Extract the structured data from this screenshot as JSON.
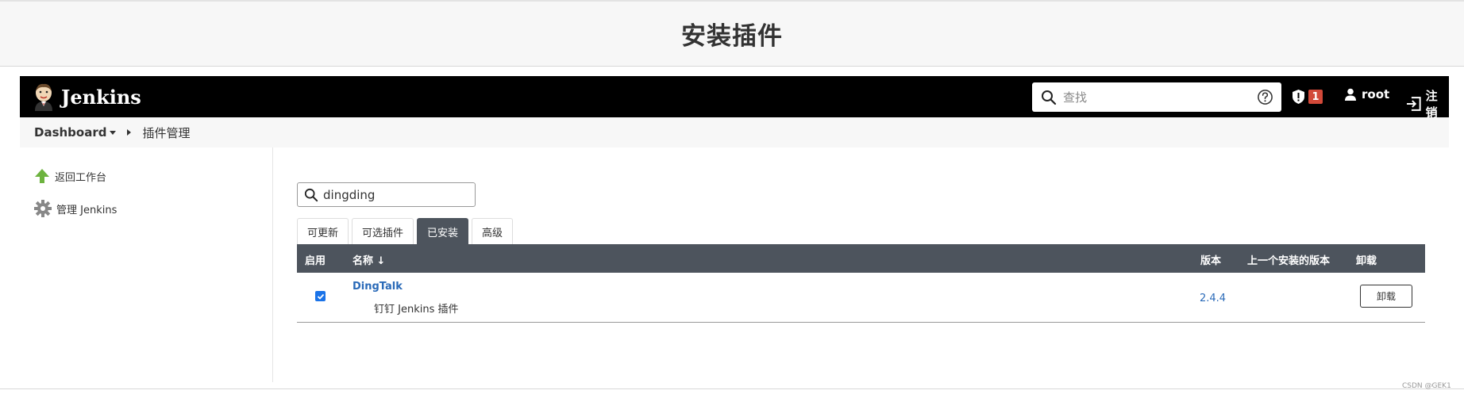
{
  "page_title": "安装插件",
  "topbar": {
    "brand": "Jenkins",
    "search_placeholder": "查找",
    "alert_count": "1",
    "user": "root",
    "logout": "注销"
  },
  "breadcrumb": {
    "dashboard": "Dashboard",
    "current": "插件管理"
  },
  "sidebar": {
    "items": [
      {
        "label": "返回工作台",
        "icon": "up-arrow-icon"
      },
      {
        "label": "管理 Jenkins",
        "icon": "gear-icon"
      }
    ]
  },
  "filter": {
    "value": "dingding"
  },
  "tabs": [
    {
      "label": "可更新",
      "active": false
    },
    {
      "label": "可选插件",
      "active": false
    },
    {
      "label": "已安装",
      "active": true
    },
    {
      "label": "高级",
      "active": false
    }
  ],
  "table": {
    "headers": {
      "enabled": "启用",
      "name": "名称 ↓",
      "version": "版本",
      "previous": "上一个安装的版本",
      "uninstall": "卸载"
    },
    "rows": [
      {
        "enabled": true,
        "name": "DingTalk",
        "description": "钉钉 Jenkins 插件",
        "version": "2.4.4",
        "uninstall_label": "卸载"
      }
    ]
  },
  "watermark": "CSDN @GEK1",
  "colors": {
    "topbar": "#000000",
    "table_header": "#4d545d",
    "link": "#2a6ab8",
    "badge": "#d24939"
  }
}
